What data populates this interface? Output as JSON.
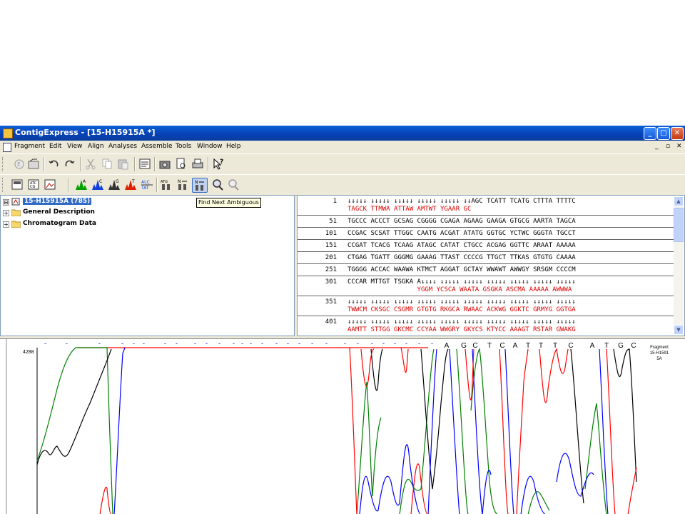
{
  "window": {
    "title": "ContigExpress - [15-H15915A *]",
    "controls": [
      "_",
      "□",
      "✕"
    ]
  },
  "menubar": {
    "items": [
      "Fragment",
      "Edit",
      "View",
      "Align",
      "Analyses",
      "Assemble",
      "Tools",
      "Window",
      "Help"
    ],
    "mdi_controls": [
      "_",
      "▫",
      "✕"
    ]
  },
  "toolbar1": {
    "icons": [
      "enzyme-icon",
      "open-folder-icon",
      "undo-icon",
      "redo-icon",
      "cut-icon",
      "copy-icon",
      "paste-icon",
      "properties-icon",
      "camera-icon",
      "print-preview-icon",
      "print-icon",
      "help-pointer-icon"
    ]
  },
  "toolbar2": {
    "icons": [
      "view-text-icon",
      "view-sequence-icon",
      "view-image-icon",
      "trace-a-icon",
      "trace-c-icon",
      "trace-g-icon",
      "trace-t-icon",
      "reverse-complement-icon",
      "find-atg-icon",
      "find-n-icon",
      "find-next-ambiguous-icon",
      "zoom-in-icon",
      "zoom-out-icon"
    ]
  },
  "tooltip": {
    "text": "Find Next Ambiguous"
  },
  "tree": {
    "items": [
      {
        "label": "15-H15915A (785)",
        "expander": "⊟",
        "selected": true
      },
      {
        "label": "General Description",
        "expander": "+",
        "selected": false
      },
      {
        "label": "Chromatogram Data",
        "expander": "+",
        "selected": false
      }
    ]
  },
  "sequence": {
    "rows": [
      {
        "num": "1",
        "top": "↓↓↓↓↓ ↓↓↓↓↓ ↓↓↓↓↓ ↓↓↓↓↓ ↓↓↓↓↓ ↓↓AGC TCATT TCATG CTTTA TTTTC",
        "bottom": "TAGCK TTMWA ATTAW AMTWT YGAAR GC"
      },
      {
        "num": "51",
        "top": "TGCCC ACCCT GCSAG CGGGG CGAGA AGAAG GAAGA GTGCG AARTA TAGCA",
        "bottom": ""
      },
      {
        "num": "101",
        "top": "CCGAC SCSAT TTGGC CAATG ACGAT ATATG GGTGC YCTWC GGGTA TGCCT",
        "bottom": ""
      },
      {
        "num": "151",
        "top": "CCGAT TCACG TCAAG ATAGC CATAT CTGCC ACGAG GGTTC ARAAT AAAAA",
        "bottom": ""
      },
      {
        "num": "201",
        "top": "CTGAG TGATT GGGMG GAAAG TTAST CCCCG TTGCT TTKAS GTGTG CAAAA",
        "bottom": ""
      },
      {
        "num": "251",
        "top": "TGGGG ACCAC WAAWA KTMCT AGGAT GCTAY WWAWT AWWGY SRSGM CCCCM",
        "bottom": ""
      },
      {
        "num": "301",
        "top": "CCCAR MTTGT TSGKA A↓↓↓↓ ↓↓↓↓↓ ↓↓↓↓↓ ↓↓↓↓↓ ↓↓↓↓↓ ↓↓↓↓↓ ↓↓↓↓↓",
        "bottom": "                  YGGM YCSCA WAATA GSGKA ASCMA AAAAA AWWWA"
      },
      {
        "num": "351",
        "top": "↓↓↓↓↓ ↓↓↓↓↓ ↓↓↓↓↓ ↓↓↓↓↓ ↓↓↓↓↓ ↓↓↓↓↓ ↓↓↓↓↓ ↓↓↓↓↓ ↓↓↓↓↓ ↓↓↓↓↓",
        "bottom": "TWWCM CKSGC CSGMR GTGTG RKGCA RWAAC ACKWG GGKTC GRMYG GGTGA"
      },
      {
        "num": "401",
        "top": "↓↓↓↓↓ ↓↓↓↓↓ ↓↓↓↓↓ ↓↓↓↓↓ ↓↓↓↓↓ ↓↓↓↓↓ ↓↓↓↓↓ ↓↓↓↓↓ ↓↓↓↓↓ ↓↓↓↓↓",
        "bottom": "AAMTT STTGG GKCMC CCYAA WWGRY GKYCS KTYCC AAAGT RSTAR GWAKG"
      }
    ]
  },
  "chromatogram": {
    "y_max_label": "4288",
    "bases": [
      "A",
      "G",
      "C",
      "T",
      "C",
      "A",
      "T",
      "T",
      "T",
      "C",
      "A",
      "T",
      "G",
      "C"
    ],
    "fragment_label": [
      "Fragment",
      "15-H1591",
      "5A"
    ],
    "colors": {
      "A": "#008000",
      "C": "#0000ff",
      "G": "#000000",
      "T": "#ff0000"
    }
  }
}
